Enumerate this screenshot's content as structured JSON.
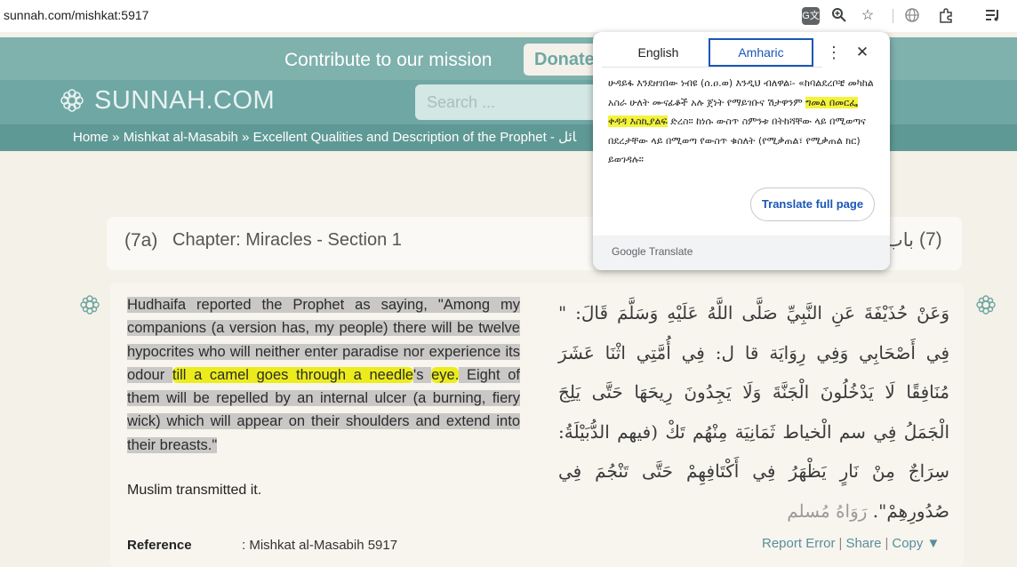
{
  "browser": {
    "url": "sunnah.com/mishkat:5917",
    "icons": [
      "translate-icon",
      "zoom-icon",
      "star-icon",
      "globe-icon",
      "extensions-icon",
      "media-icon"
    ]
  },
  "site": {
    "mission_text": "Contribute to our mission",
    "donate_label": "Donate",
    "logo_text": "SUNNAH.COM",
    "search_placeholder": "Search ...",
    "breadcrumb": "Home » Mishkat al-Masabih » Excellent Qualities and Description of the Prophet - ﺎﺋﻞ"
  },
  "chapter": {
    "number": "(7a)",
    "title": "Chapter: Miracles - Section 1",
    "arabic_title": "باب",
    "arabic_number": "(7)"
  },
  "hadith": {
    "english_sel_1": "Hudhaifa reported the Prophet as saying, \"Among my companions (a version has, my people) there will be twelve hypocrites who will neither enter paradise nor experience its odour ",
    "english_hl_1": "till a camel goes through a needle",
    "english_sel_2": "'s ",
    "english_hl_2": "eye.",
    "english_sel_3": " Eight of them will be repelled by an internal ulcer (a burning, fiery wick) which will appear on their shoulders and extend into their breasts.\"",
    "transmitted": "Muslim transmitted it.",
    "arabic_main": "وَعَنْ حُذَيْفَةَ عَنِ النَّبِيِّ صَلَّى اللَّهُ عَلَيْهِ وَسَلَّمَ قَالَ: \" فِي أَصْحَابِي وَفِي رِوَايَة قا ل: فِي أُمَّتِي اثْنَا عَشَرَ مُنَافِقًا لَا يَدْخُلُونَ الْجَنَّةَ وَلَا يَجِدُونَ رِيحَهَا حَتَّى يَلِجَ الْجَمَلُ فِي سم الْخياط ثَمَانِيَة مِنْهُم تَكْ (فيهم الدُّبَيْلَةُ: سِرَاجٌ مِنْ نَارٍ يَظْهَرُ فِي أَكْتَافِهِمْ حَتَّى تَنْجُمَ فِي صُدُورِهِمْ\".",
    "arabic_tail": " رَوَاهُ مُسلم",
    "reference_label": "Reference",
    "reference_value": ": Mishkat al-Masabih 5917",
    "report_error": "Report Error",
    "share": "Share",
    "copy": "Copy ▼"
  },
  "translate_popup": {
    "tab_english": "English",
    "tab_amharic": "Amharic",
    "text_before": "ሁዳይፋ እንደዘገበው ነብዩ (ሰ.ዐ.ወ) እንዲህ ብለዋል፡- «ከባልደረቦቼ መካከል አስራ ሁለት ሙናፊቆች አሉ ጀነት የማይገቡና ሽታዋንም ",
    "text_highlight": "ግመል በመርፌ ቀዳዳ እስኪያልፍ",
    "text_after": " ድረስ። ከነሱ ውስጥ ስምንቱ በትከሻቸው ላይ በሚወጣና በደረታቸው ላይ በሚወጣ የውስጥ ቁስለት (የሚቃጠል፣ የሚቃጠል ክር) ይወገዳሉ።",
    "full_page_label": "Translate full page",
    "footer_google": "Google",
    "footer_translate": " Translate"
  },
  "colors": {
    "header_teal": "#6ea7a3",
    "highlight_yellow": "#ecec1d",
    "selection_grey": "#c9c8c6",
    "link_blue": "#1a56b7"
  }
}
